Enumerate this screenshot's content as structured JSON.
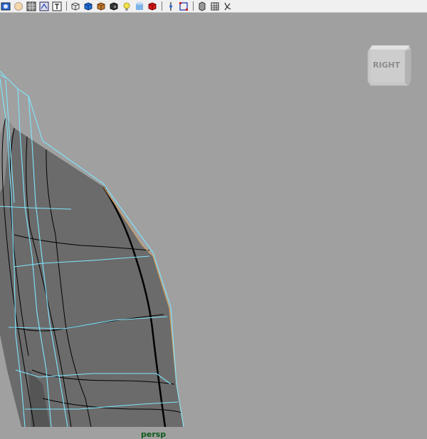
{
  "toolbar": {
    "groups": [
      [
        "select-camera",
        "light-bulb",
        "wireframe-grid",
        "uv-editor",
        "text-label"
      ],
      [
        "cube-wireframe",
        "shaded-blue-cube",
        "textured-cube",
        "dark-shaded",
        "default-light",
        "blue-cylinder",
        "red-cube"
      ],
      [
        "isolate-select",
        "xray"
      ],
      [
        "xray-joints",
        "grid-toggle",
        "resolution-gate"
      ]
    ]
  },
  "viewport": {
    "background": "#a0a0a0",
    "viewcube": {
      "face_label": "RIGHT"
    },
    "camera_name": "persp",
    "colors": {
      "mesh_fill": "#6b6b6b",
      "mesh_edges": "#000000",
      "cage_edges": "#7fe6ff",
      "highlight_edge": "#d8a060"
    }
  }
}
